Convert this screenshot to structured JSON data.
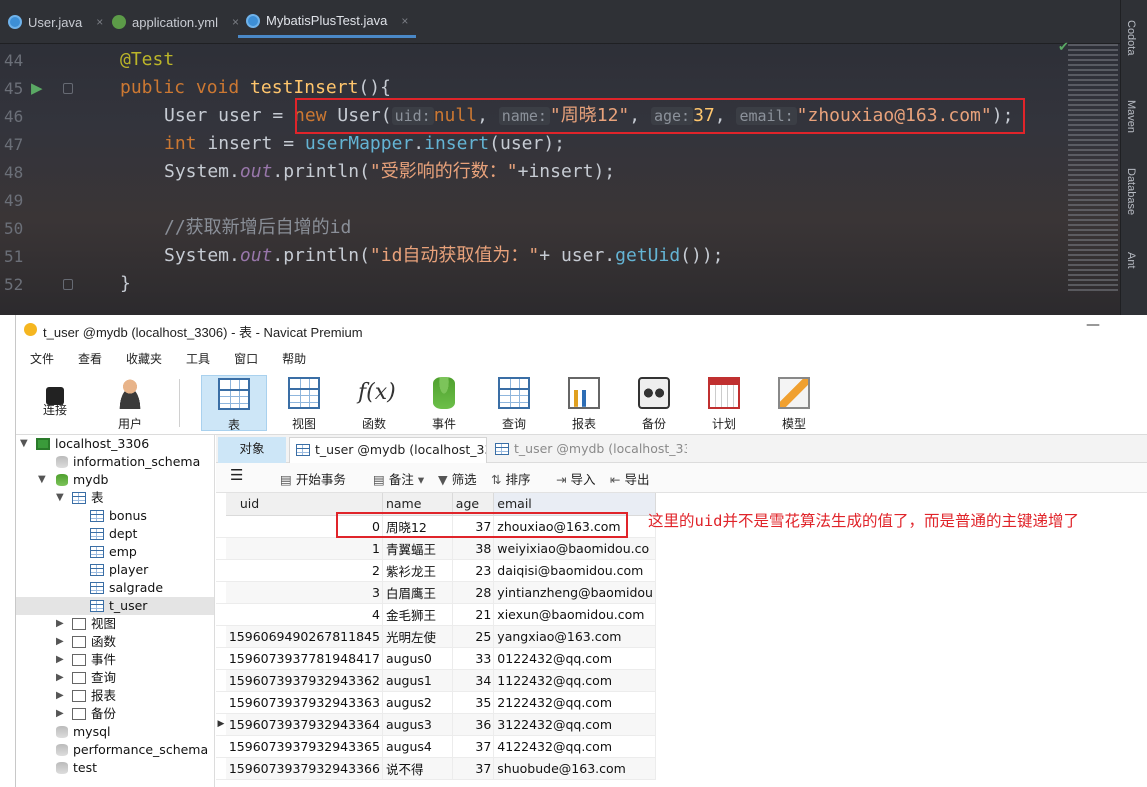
{
  "ide": {
    "tabs": [
      {
        "label": "User.java",
        "close": "×"
      },
      {
        "label": "application.yml",
        "close": "×"
      },
      {
        "label": "MybatisPlusTest.java",
        "close": "×"
      }
    ],
    "line_numbers": [
      "44",
      "45",
      "46",
      "47",
      "48",
      "49",
      "50",
      "51",
      "52"
    ],
    "code": {
      "annotation": "@Test",
      "l45_a": "public ",
      "l45_b": "void ",
      "l45_c": "testInsert",
      "l45_d": "(){",
      "l46_a": "User user = ",
      "l46_new": "new ",
      "l46_cls": "User(",
      "l46_h1": "uid:",
      "l46_null": "null",
      "l46_c1": ", ",
      "l46_h2": "name:",
      "l46_s1": "\"周晓12\"",
      "l46_c2": ", ",
      "l46_h3": "age:",
      "l46_n": "37",
      "l46_c3": ", ",
      "l46_h4": "email:",
      "l46_s2": "\"zhouxiao@163.com\"",
      "l46_end": ");",
      "l47_a": "int ",
      "l47_b": "insert = ",
      "l47_c": "userMapper",
      "l47_d": ".",
      "l47_e": "insert",
      "l47_f": "(user);",
      "l48_a": "System.",
      "l48_b": "out",
      "l48_c": ".println(",
      "l48_s": "\"受影响的行数：\"",
      "l48_d": "+insert);",
      "l50": "//获取新增后自增的id",
      "l51_a": "System.",
      "l51_b": "out",
      "l51_c": ".println(",
      "l51_s": "\"id自动获取值为：\"",
      "l51_d": "+ user.",
      "l51_e": "getUid",
      "l51_f": "());",
      "l52": "}"
    },
    "side_tabs": [
      "Codota",
      "Maven",
      "Database",
      "Ant"
    ]
  },
  "navicat": {
    "title": "t_user @mydb (localhost_3306) - 表 - Navicat Premium",
    "menu": [
      "文件",
      "查看",
      "收藏夹",
      "工具",
      "窗口",
      "帮助"
    ],
    "toolbar": [
      {
        "label": "连接",
        "icon": "plug-icon"
      },
      {
        "label": "用户",
        "icon": "user-icon"
      },
      {
        "label": "表",
        "icon": "table-icon",
        "active": true
      },
      {
        "label": "视图",
        "icon": "view-icon"
      },
      {
        "label": "函数",
        "icon": "function-icon"
      },
      {
        "label": "事件",
        "icon": "event-icon"
      },
      {
        "label": "查询",
        "icon": "query-icon"
      },
      {
        "label": "报表",
        "icon": "report-icon"
      },
      {
        "label": "备份",
        "icon": "backup-icon"
      },
      {
        "label": "计划",
        "icon": "calendar-icon"
      },
      {
        "label": "模型",
        "icon": "model-icon"
      }
    ],
    "tree": {
      "connection": "localhost_3306",
      "databases": [
        "information_schema",
        "mydb"
      ],
      "tables_label": "表",
      "tables": [
        "bonus",
        "dept",
        "emp",
        "player",
        "salgrade",
        "t_user"
      ],
      "groups": [
        "视图",
        "函数",
        "事件",
        "查询",
        "报表",
        "备份"
      ],
      "other_dbs": [
        "mysql",
        "performance_schema",
        "test"
      ]
    },
    "tabs": [
      "对象",
      "t_user @mydb (localhost_33...",
      "t_user @mydb (localhost_33..."
    ],
    "grid_tools": [
      "开始事务",
      "备注",
      "筛选",
      "排序",
      "导入",
      "导出"
    ],
    "columns": [
      "uid",
      "name",
      "age",
      "email"
    ],
    "rows": [
      [
        "0",
        "周晓12",
        "37",
        "zhouxiao@163.com"
      ],
      [
        "1",
        "青翼蝠王",
        "38",
        "weiyixiao@baomidou.co"
      ],
      [
        "2",
        "紫衫龙王",
        "23",
        "daiqisi@baomidou.com"
      ],
      [
        "3",
        "白眉鹰王",
        "28",
        "yintianzheng@baomidou"
      ],
      [
        "4",
        "金毛狮王",
        "21",
        "xiexun@baomidou.com"
      ],
      [
        "1596069490267811845",
        "光明左使",
        "25",
        "yangxiao@163.com"
      ],
      [
        "1596073937781948417",
        "augus0",
        "33",
        "0122432@qq.com"
      ],
      [
        "1596073937932943362",
        "augus1",
        "34",
        "1122432@qq.com"
      ],
      [
        "1596073937932943363",
        "augus2",
        "35",
        "2122432@qq.com"
      ],
      [
        "1596073937932943364",
        "augus3",
        "36",
        "3122432@qq.com"
      ],
      [
        "1596073937932943365",
        "augus4",
        "37",
        "4122432@qq.com"
      ],
      [
        "1596073937932943366",
        "说不得",
        "37",
        "shuobude@163.com"
      ]
    ],
    "note": "这里的uid并不是雪花算法生成的值了，而是普通的主键递增了"
  }
}
